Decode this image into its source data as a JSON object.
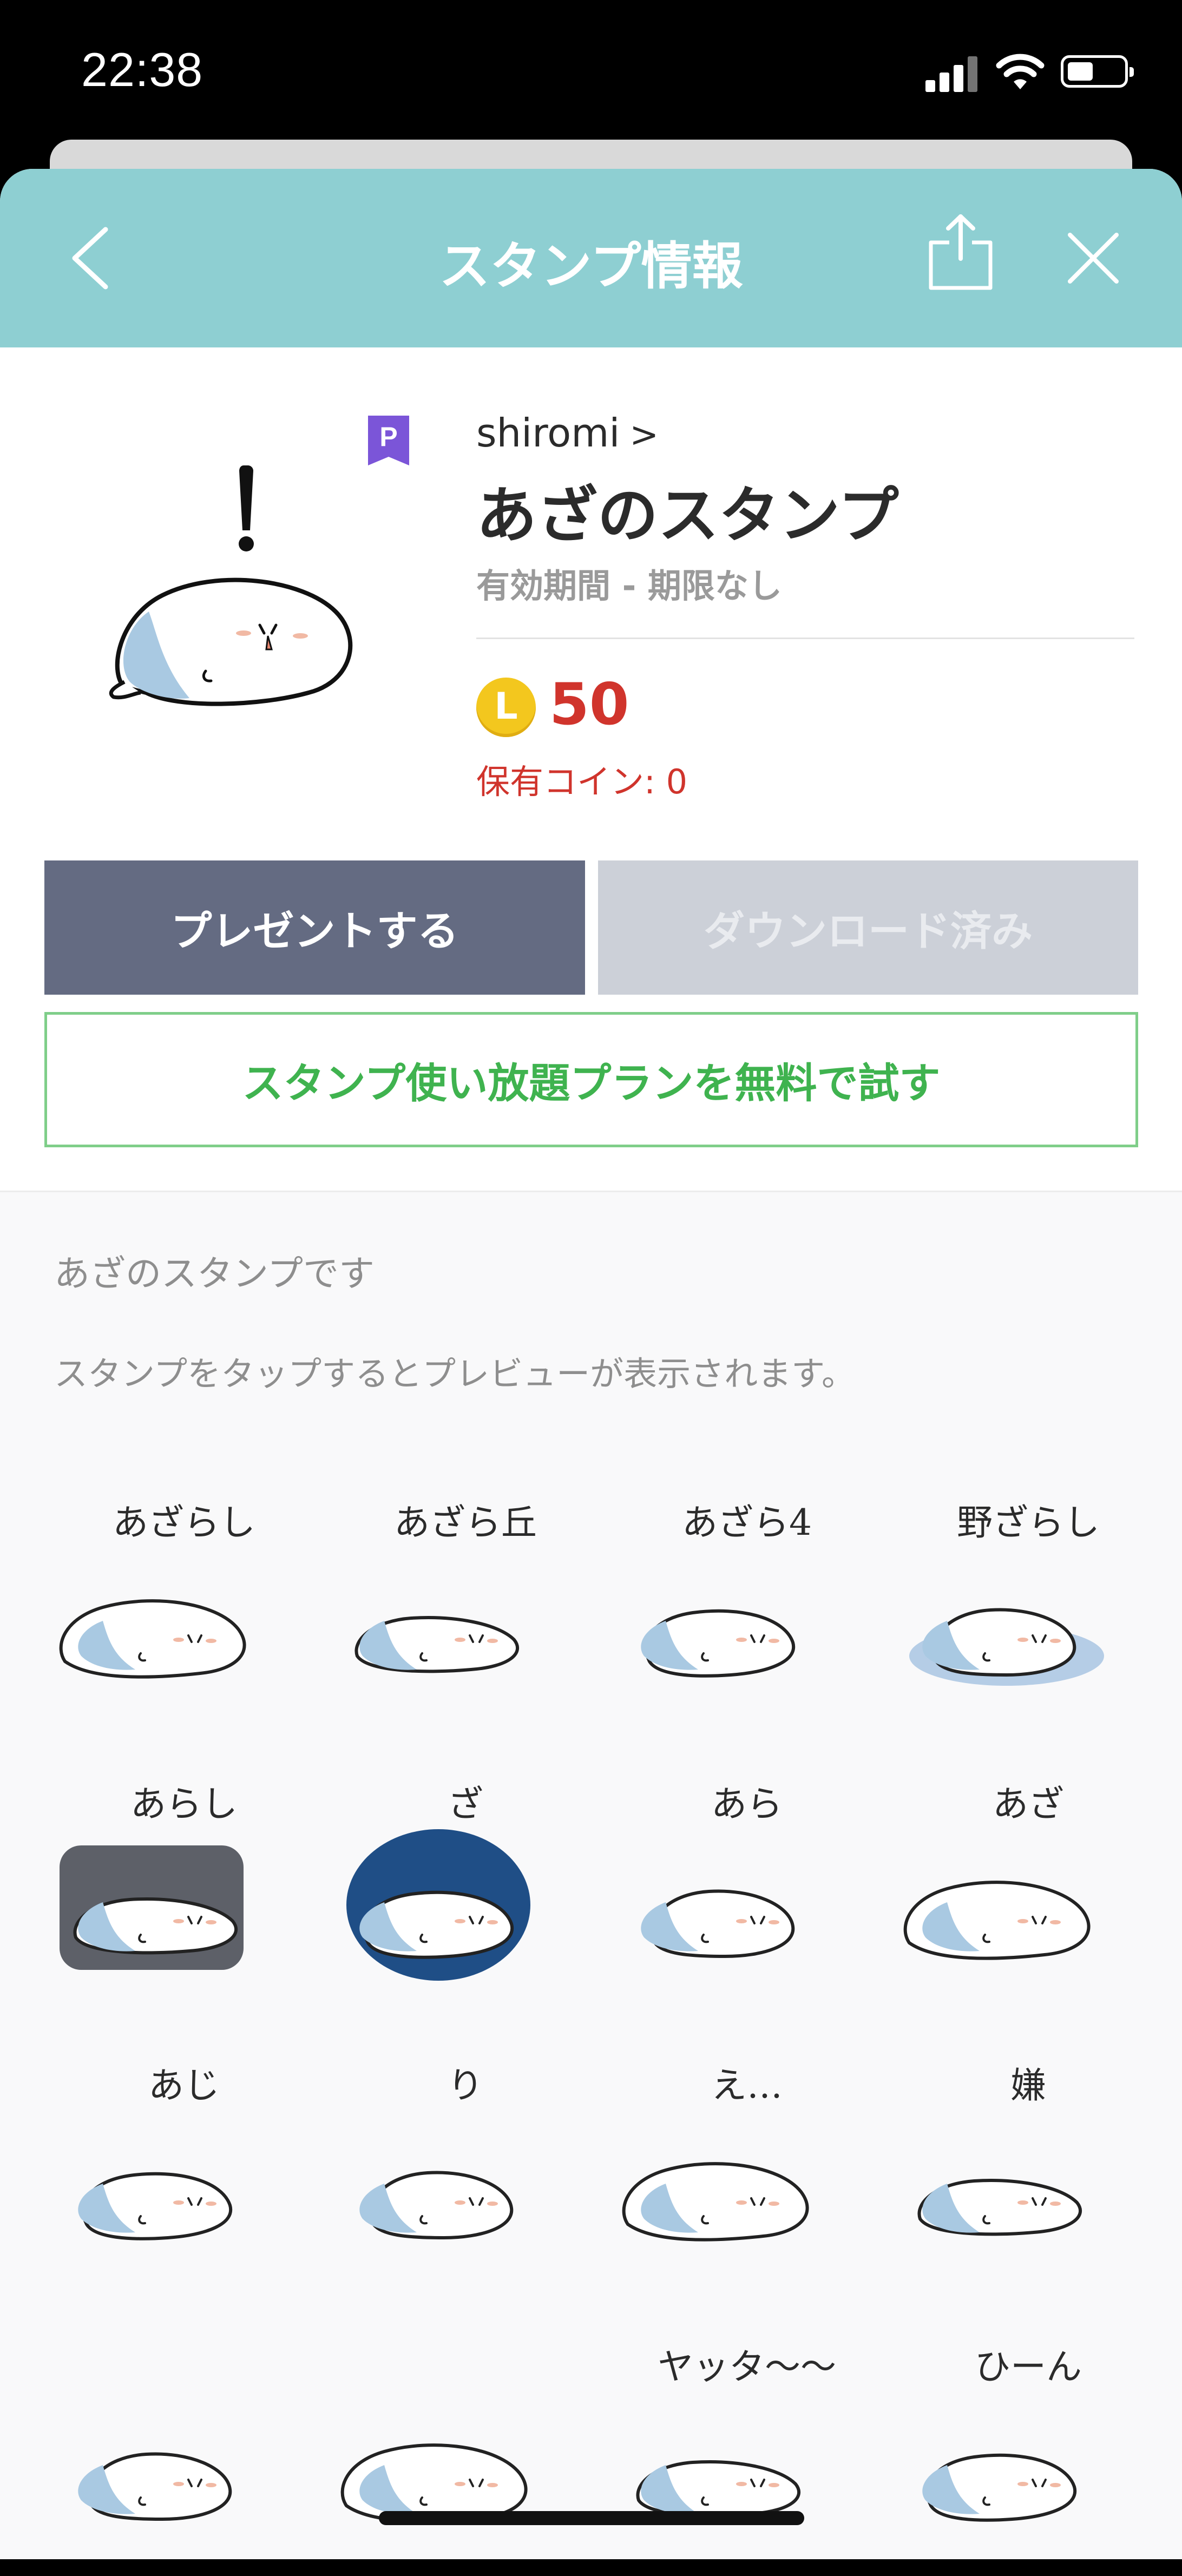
{
  "status_bar": {
    "time": "22:38"
  },
  "header": {
    "title": "スタンプ情報"
  },
  "sticker": {
    "author": "shiromi",
    "title": "あざのスタンプ",
    "validity": "有効期間 - 期限なし",
    "coin_symbol": "L",
    "price": "50",
    "owned_coins": "保有コイン: 0",
    "premium_badge": "P"
  },
  "actions": {
    "gift": "プレゼントする",
    "downloaded": "ダウンロード済み",
    "trial": "スタンプ使い放題プランを無料で試す"
  },
  "description": "あざのスタンプです",
  "hint": "スタンプをタップするとプレビューが表示されます。",
  "stickers": [
    {
      "label": "あざらし"
    },
    {
      "label": "あざら丘"
    },
    {
      "label": "あざら4"
    },
    {
      "label": "野ざらし"
    },
    {
      "label": "あらし"
    },
    {
      "label": "ざ"
    },
    {
      "label": "あら"
    },
    {
      "label": "あざ"
    },
    {
      "label": "あじ"
    },
    {
      "label": "り"
    },
    {
      "label": "え…"
    },
    {
      "label": "嫌"
    },
    {
      "label": ""
    },
    {
      "label": ""
    },
    {
      "label": "ヤッタ〜〜"
    },
    {
      "label": "ひーん"
    }
  ],
  "colors": {
    "header": "#8ecfd2",
    "gift_button": "#646b82",
    "downloaded_button": "#ccd0d8",
    "trial_border": "#7fce89",
    "trial_text": "#3fb34f",
    "price": "#d0342c",
    "coin": "#f3c71e",
    "premium_badge": "#7b55d8"
  }
}
